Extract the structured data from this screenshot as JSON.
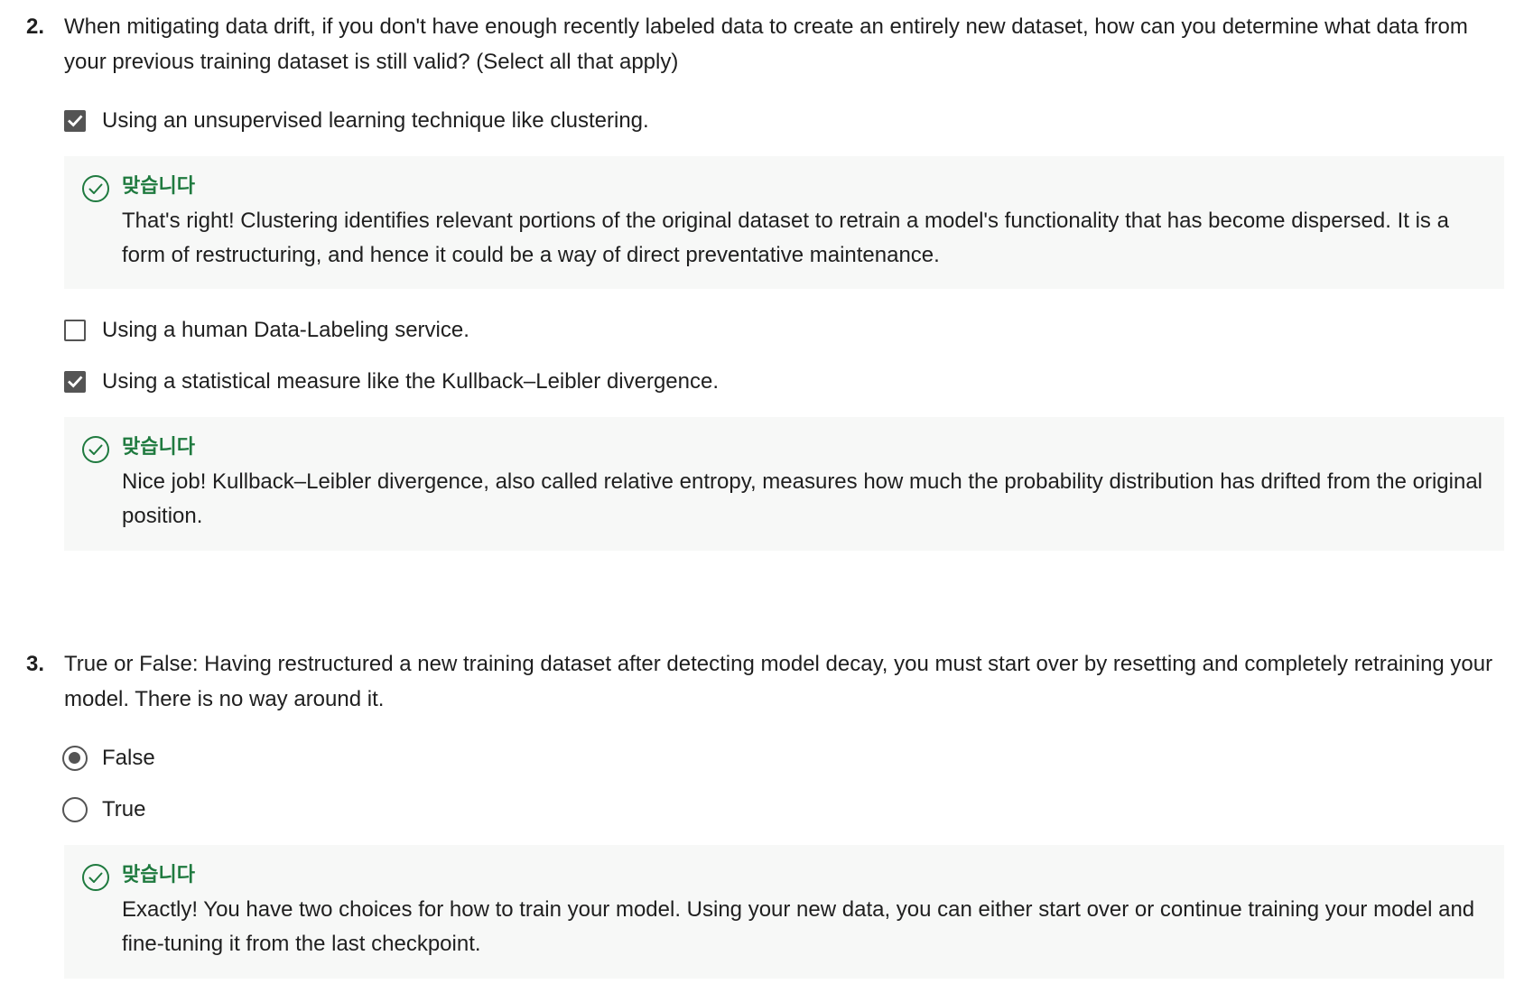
{
  "colors": {
    "correct_green": "#1f7a3f",
    "control_gray": "#545454",
    "feedback_bg": "#f7f8f7"
  },
  "questions": [
    {
      "number": "2.",
      "text": "When mitigating data drift, if you don't have enough recently labeled data to create an entirely new dataset, how can you determine what data from your previous training dataset is still valid? (Select all that apply)",
      "options": [
        {
          "label": "Using an unsupervised learning technique like clustering.",
          "checked": true,
          "feedback": {
            "title": "맞습니다",
            "icon": "check-circle-icon",
            "text": "That's right! Clustering identifies relevant portions of the original dataset to retrain a model's functionality that has become dispersed. It is a form of restructuring, and hence it could be a way of direct preventative maintenance."
          }
        },
        {
          "label": "Using a human Data-Labeling service.",
          "checked": false
        },
        {
          "label": "Using a statistical measure like the Kullback–Leibler divergence.",
          "checked": true,
          "feedback": {
            "title": "맞습니다",
            "icon": "check-circle-icon",
            "text": "Nice job! Kullback–Leibler divergence, also called relative entropy, measures how much the probability distribution has drifted from the original position."
          }
        }
      ]
    },
    {
      "number": "3.",
      "text": "True or False: Having restructured a new training dataset after detecting model decay, you must start over by resetting and completely retraining your model. There is no way around it.",
      "options": [
        {
          "label": "False",
          "checked": true
        },
        {
          "label": "True",
          "checked": false
        }
      ],
      "feedback": {
        "title": "맞습니다",
        "icon": "check-circle-icon",
        "text": "Exactly! You have two choices for how to train your model. Using your new data, you can either start over or continue training your model and fine-tuning it from the last checkpoint."
      }
    }
  ]
}
